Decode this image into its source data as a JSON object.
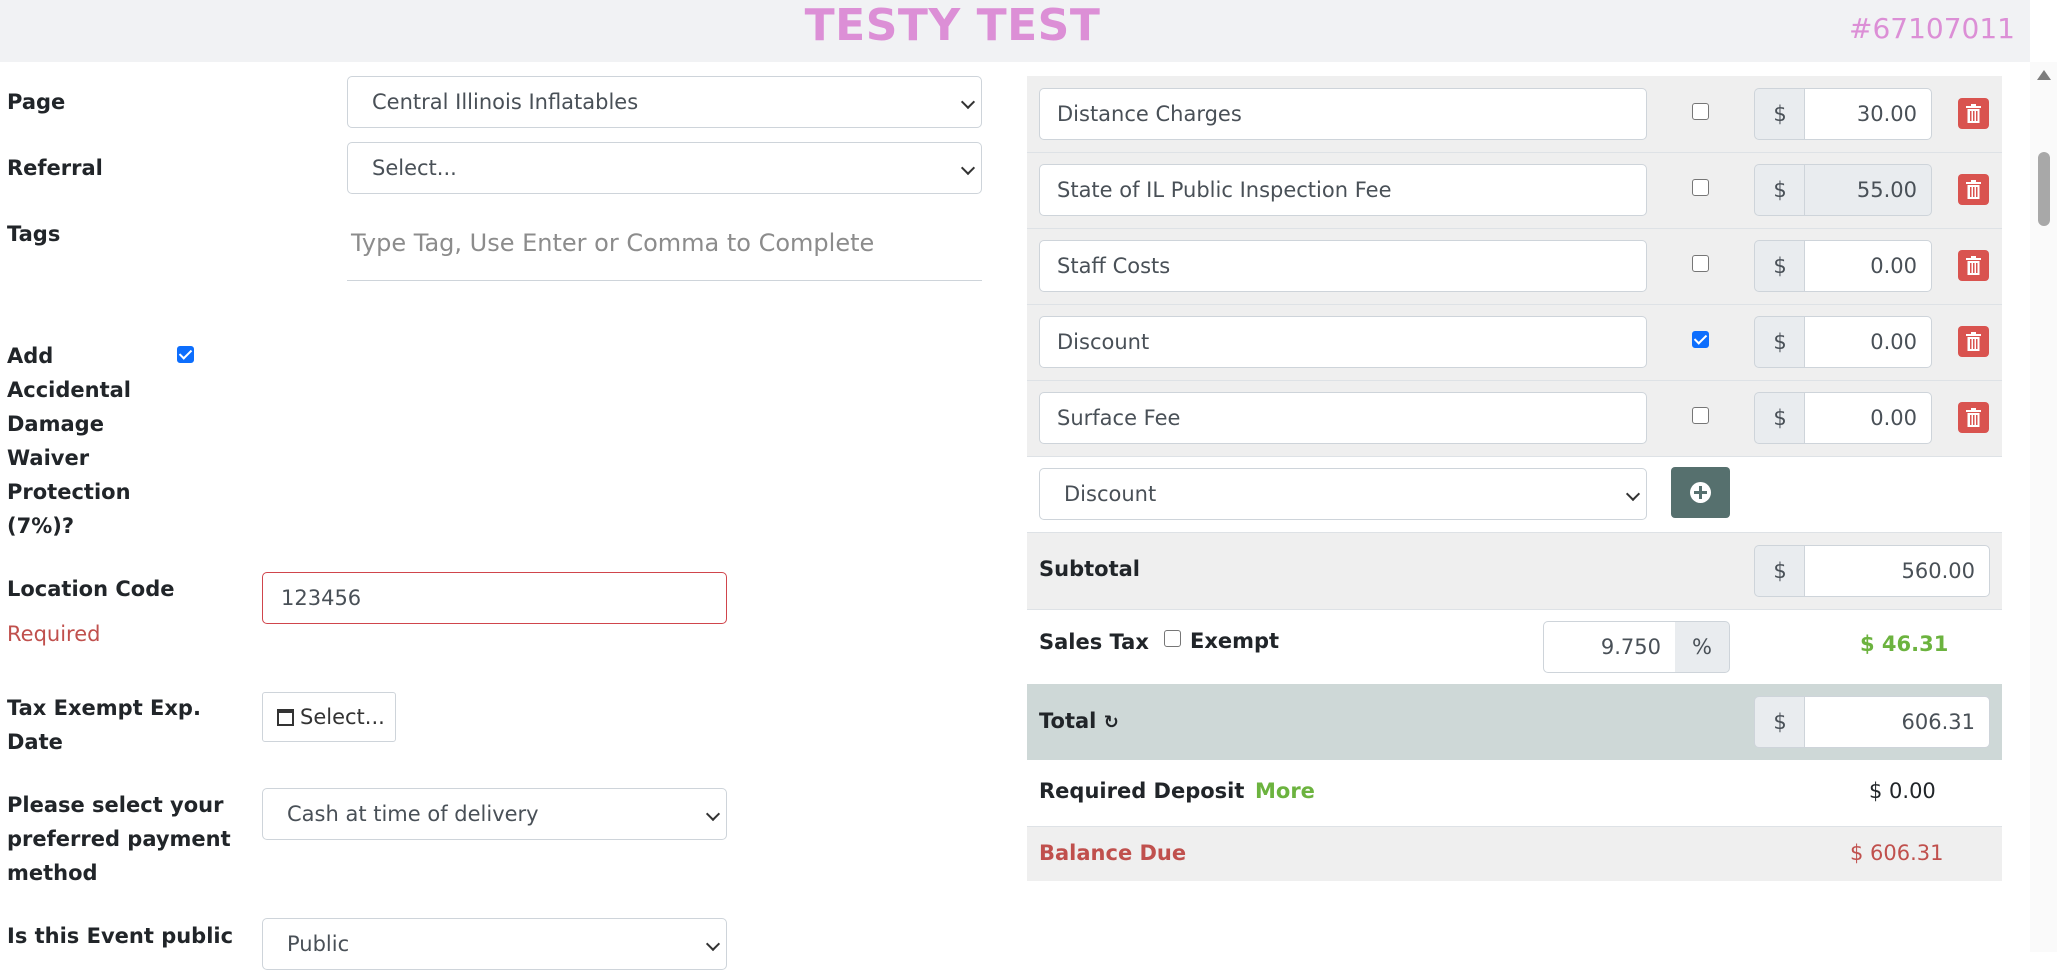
{
  "header": {
    "title": "TESTY TEST",
    "order_number": "#67107011"
  },
  "left": {
    "page": {
      "label": "Page",
      "value": "Central Illinois Inflatables"
    },
    "referral": {
      "label": "Referral",
      "value": "Select..."
    },
    "tags": {
      "label": "Tags",
      "placeholder": "Type Tag, Use Enter or Comma to Complete"
    },
    "damage_waiver": {
      "label_lines": [
        "Add",
        "Accidental",
        "Damage",
        "Waiver",
        "Protection",
        "(7%)?"
      ],
      "checked": true
    },
    "location_code": {
      "label": "Location Code",
      "value": "123456",
      "error": "Required"
    },
    "tax_exempt": {
      "label_lines": [
        "Tax Exempt Exp.",
        "Date"
      ],
      "button": "Select..."
    },
    "payment": {
      "label_lines": [
        "Please select your",
        "preferred payment",
        "method"
      ],
      "value": "Cash at time of delivery"
    },
    "public": {
      "label": "Is this Event public",
      "value": "Public"
    }
  },
  "fees": [
    {
      "name": "Distance Charges",
      "checked": false,
      "currency": "$",
      "amount": "30.00",
      "readonly": false
    },
    {
      "name": "State of IL Public Inspection Fee",
      "checked": false,
      "currency": "$",
      "amount": "55.00",
      "readonly": true
    },
    {
      "name": "Staff Costs",
      "checked": false,
      "currency": "$",
      "amount": "0.00",
      "readonly": false
    },
    {
      "name": "Discount",
      "checked": true,
      "currency": "$",
      "amount": "0.00",
      "readonly": false
    },
    {
      "name": "Surface Fee",
      "checked": false,
      "currency": "$",
      "amount": "0.00",
      "readonly": false
    }
  ],
  "add_fee": {
    "value": "Discount"
  },
  "summary": {
    "subtotal": {
      "label": "Subtotal",
      "currency": "$",
      "value": "560.00"
    },
    "sales_tax": {
      "label": "Sales Tax",
      "exempt_label": "Exempt",
      "rate": "9.750",
      "pct": "%",
      "amount": "$ 46.31"
    },
    "total": {
      "label": "Total",
      "currency": "$",
      "value": "606.31"
    },
    "deposit": {
      "label": "Required Deposit",
      "more": "More",
      "value": "$ 0.00"
    },
    "balance": {
      "label": "Balance Due",
      "value": "$ 606.31"
    }
  },
  "colors": {
    "accent": "#dc8fd6",
    "danger": "#d9534f",
    "success": "#6cb33f",
    "total_row": "#ced8d7"
  }
}
